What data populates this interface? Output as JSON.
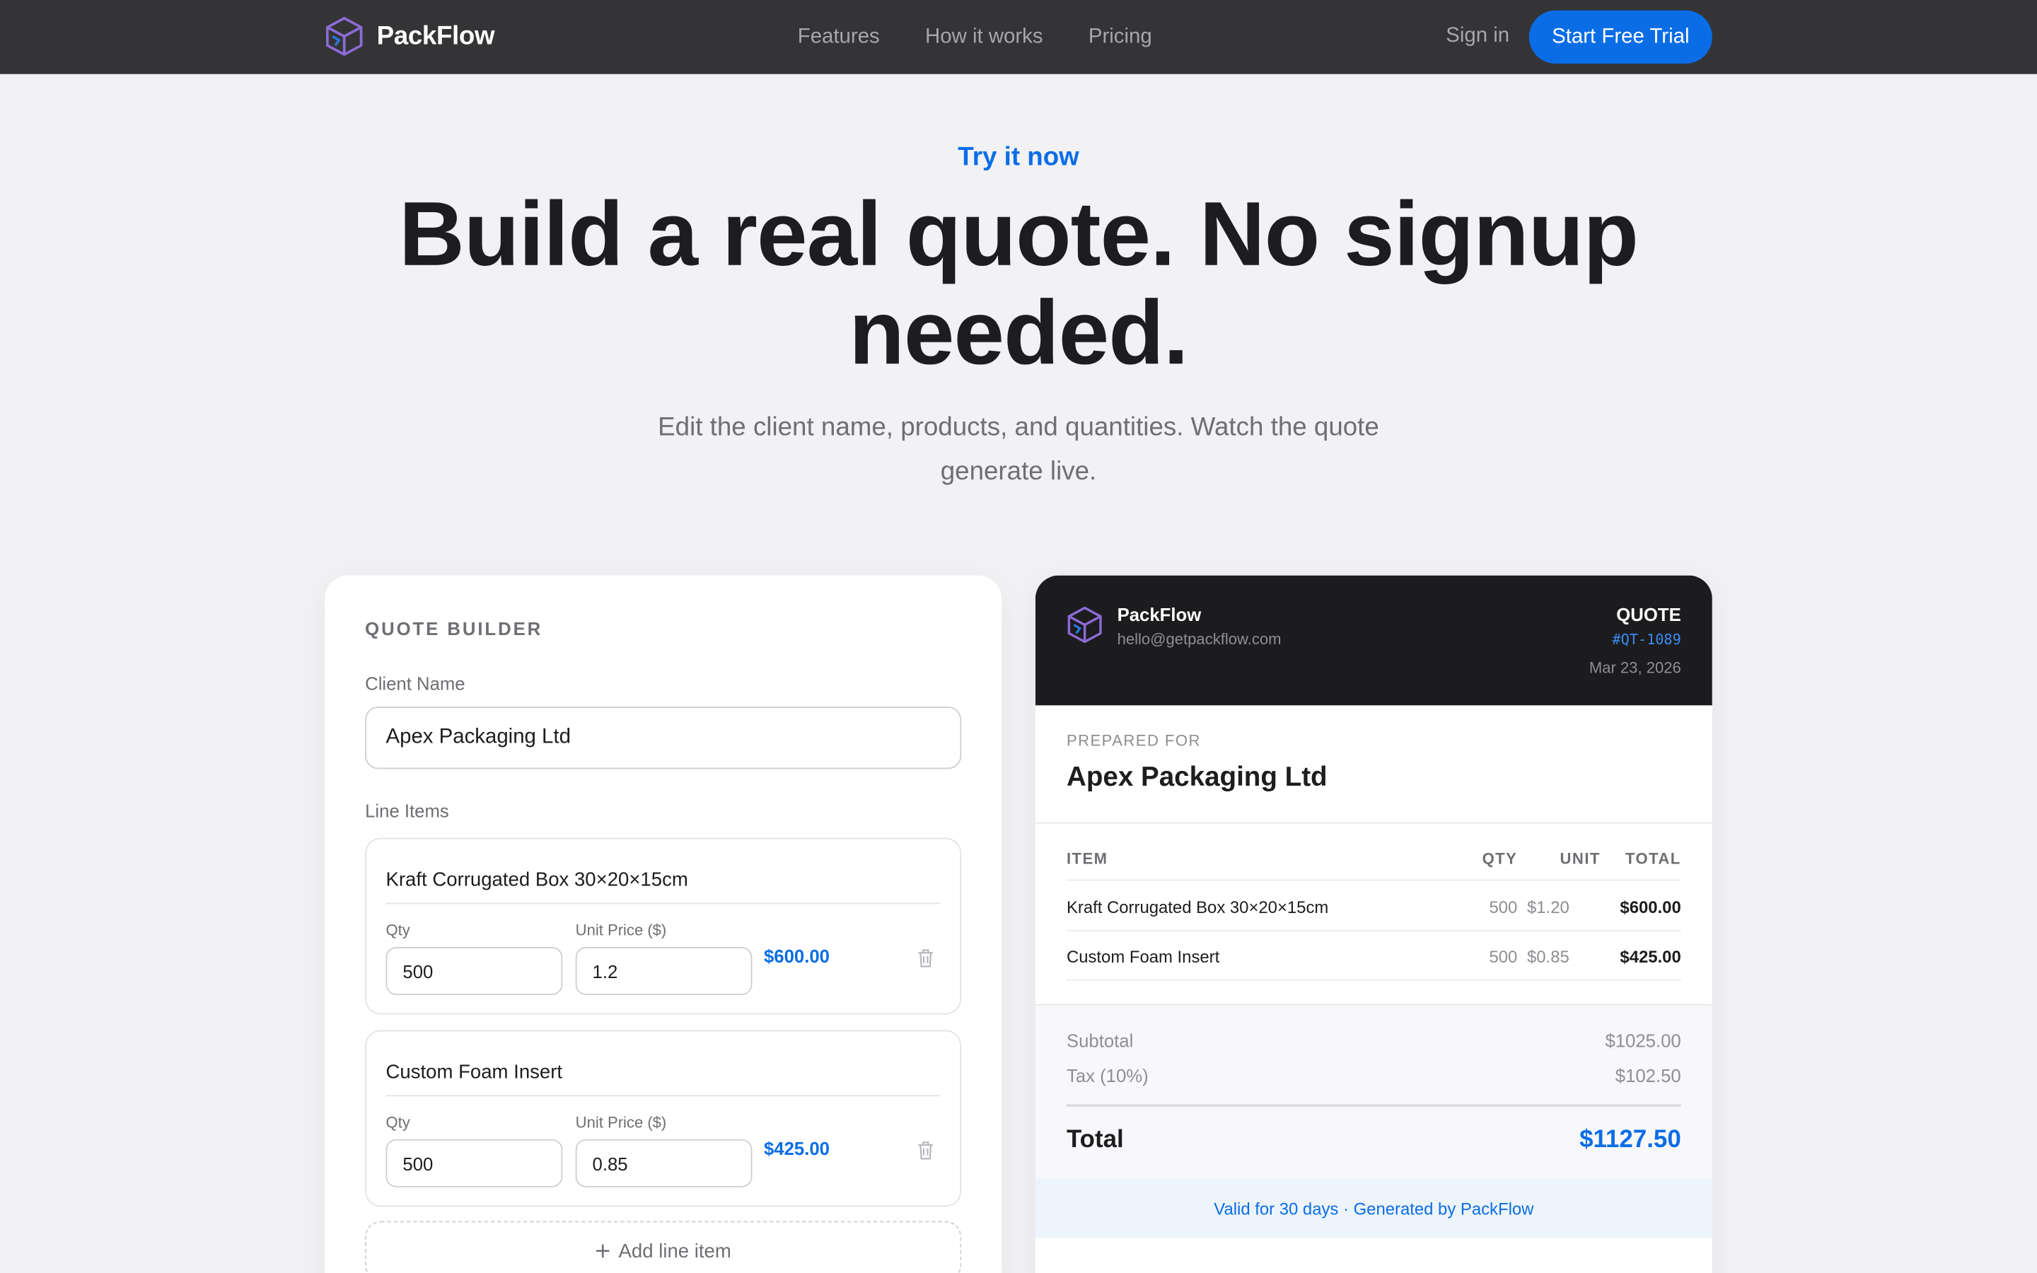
{
  "nav": {
    "brand": "PackFlow",
    "links": [
      "Features",
      "How it works",
      "Pricing"
    ],
    "signin": "Sign in",
    "cta": "Start Free Trial"
  },
  "hero": {
    "eyebrow": "Try it now",
    "headline": "Build a real quote. No signup needed.",
    "sub": "Edit the client name, products, and quantities. Watch the quote generate live."
  },
  "builder": {
    "title": "QUOTE BUILDER",
    "client_label": "Client Name",
    "client_value": "Apex Packaging Ltd",
    "line_items_label": "Line Items",
    "qty_label": "Qty",
    "price_label": "Unit Price ($)",
    "items": [
      {
        "name": "Kraft Corrugated Box 30×20×15cm",
        "qty": "500",
        "price": "1.2",
        "total": "$600.00"
      },
      {
        "name": "Custom Foam Insert",
        "qty": "500",
        "price": "0.85",
        "total": "$425.00"
      }
    ],
    "add_label": "Add line item"
  },
  "quote": {
    "brand": "PackFlow",
    "email": "hello@getpackflow.com",
    "word": "QUOTE",
    "number": "#QT-1089",
    "date": "Mar 23, 2026",
    "prepared_label": "PREPARED FOR",
    "client": "Apex Packaging Ltd",
    "headers": {
      "item": "ITEM",
      "qty": "QTY",
      "unit": "UNIT",
      "total": "TOTAL"
    },
    "rows": [
      {
        "item": "Kraft Corrugated Box 30×20×15cm",
        "qty": "500",
        "unit": "$1.20",
        "total": "$600.00"
      },
      {
        "item": "Custom Foam Insert",
        "qty": "500",
        "unit": "$0.85",
        "total": "$425.00"
      }
    ],
    "subtotal_label": "Subtotal",
    "subtotal": "$1025.00",
    "tax_label": "Tax (10%)",
    "tax": "$102.50",
    "total_label": "Total",
    "total": "$1127.50",
    "footer": "Valid for 30 days · Generated by PackFlow"
  },
  "colors": {
    "accent": "#0a6de6",
    "nav_bg": "#343436",
    "quote_header_bg": "#1c1c1e",
    "page_bg": "#f2f2f4",
    "logo": "#8c6bd6"
  },
  "icons": {
    "logo": "cube-logo-icon",
    "delete": "trash-icon",
    "add": "plus-icon"
  }
}
